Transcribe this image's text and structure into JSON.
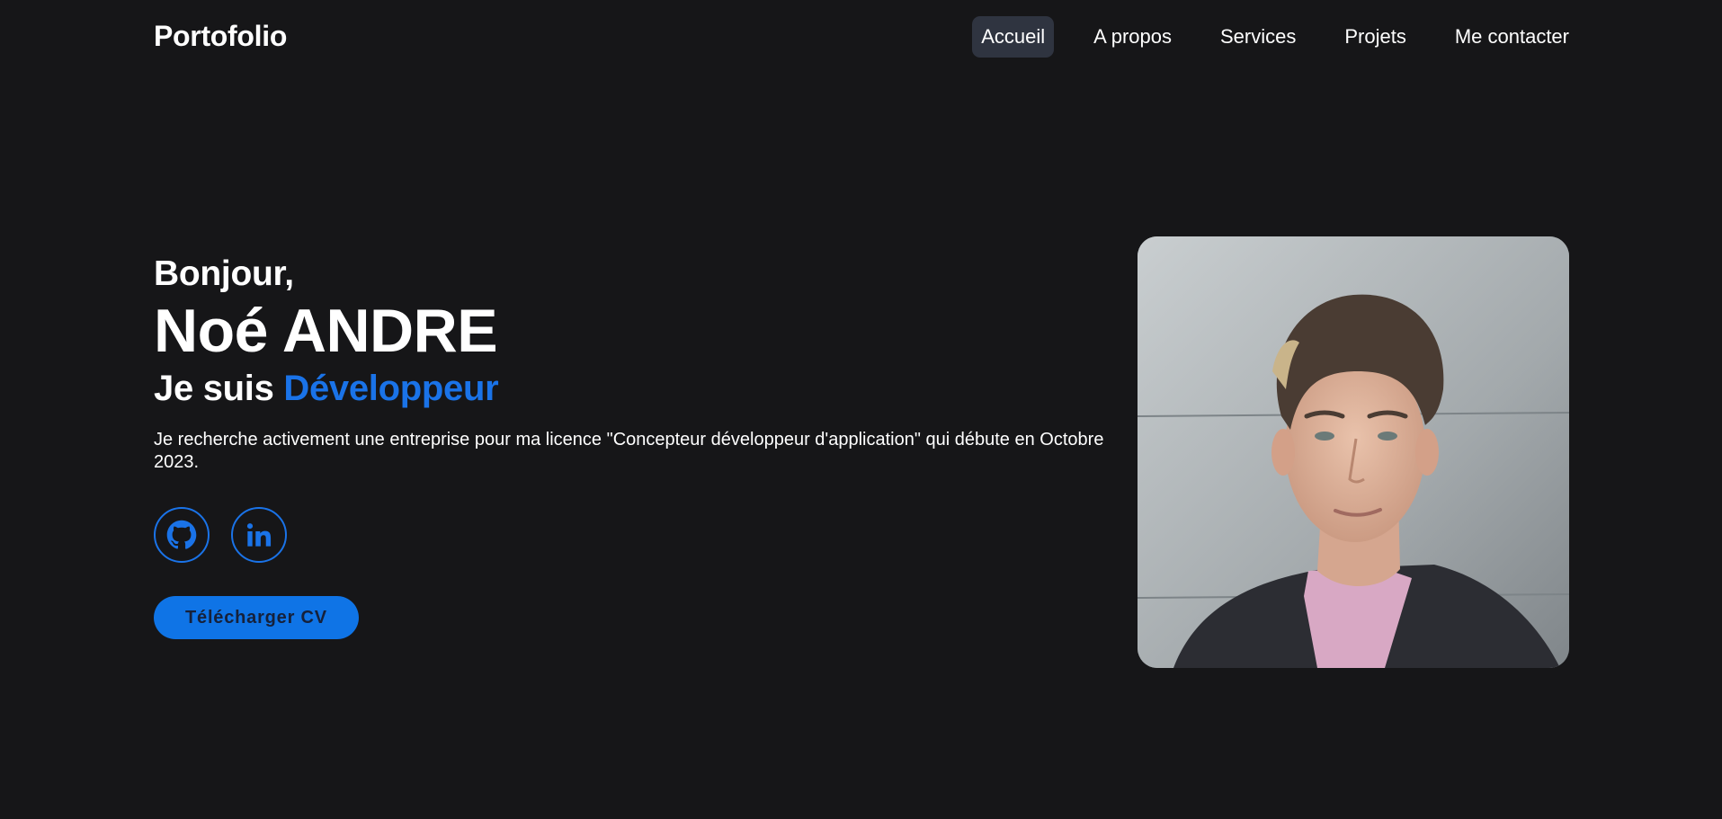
{
  "header": {
    "logo": "Portofolio",
    "nav": [
      {
        "label": "Accueil",
        "active": true
      },
      {
        "label": "A propos",
        "active": false
      },
      {
        "label": "Services",
        "active": false
      },
      {
        "label": "Projets",
        "active": false
      },
      {
        "label": "Me contacter",
        "active": false
      }
    ]
  },
  "hero": {
    "greeting": "Bonjour,",
    "name": "Noé ANDRE",
    "role_prefix": "Je suis",
    "role_highlight": "Développeur",
    "description": "Je recherche activement une entreprise pour ma licence \"Concepteur développeur d'application\" qui débute en Octobre 2023.",
    "socials": [
      {
        "icon": "github-icon"
      },
      {
        "icon": "linkedin-icon"
      }
    ],
    "cv_button": "Télécharger CV"
  },
  "photo": {
    "subject": "profile-photo"
  },
  "colors": {
    "background": "#161618",
    "accent": "#1a73e8",
    "nav_active_bg": "#2f3440",
    "cv_button_bg": "#0f74e6"
  }
}
